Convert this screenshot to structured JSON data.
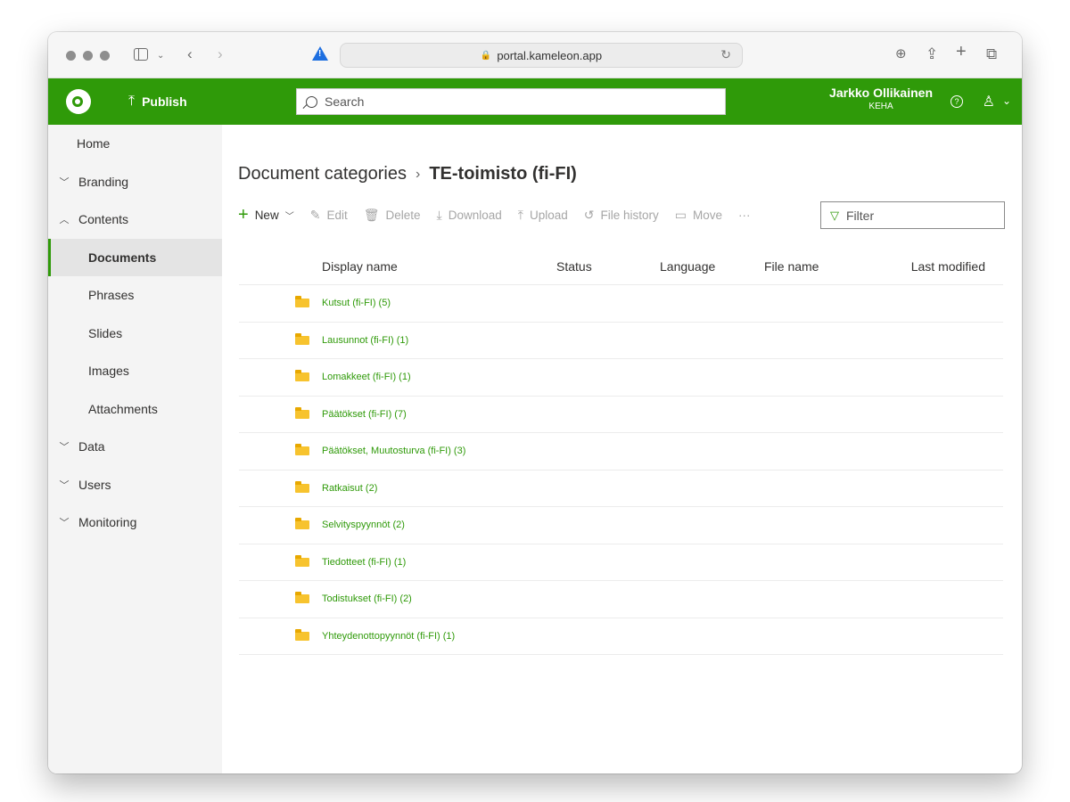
{
  "browser": {
    "url": "portal.kameleon.app"
  },
  "header": {
    "publish_label": "Publish",
    "search_placeholder": "Search",
    "user_name": "Jarkko Ollikainen",
    "user_org": "KEHA",
    "brand_color": "#2f9a09"
  },
  "nav": {
    "home": "Home",
    "branding": "Branding",
    "contents": "Contents",
    "documents": "Documents",
    "phrases": "Phrases",
    "slides": "Slides",
    "images": "Images",
    "attachments": "Attachments",
    "data": "Data",
    "users": "Users",
    "monitoring": "Monitoring"
  },
  "breadcrumb": {
    "parent": "Document categories",
    "current": "TE-toimisto (fi-FI)"
  },
  "commands": {
    "new": "New",
    "edit": "Edit",
    "delete": "Delete",
    "download": "Download",
    "upload": "Upload",
    "file_history": "File history",
    "move": "Move",
    "more": "···"
  },
  "filter": {
    "placeholder": "Filter"
  },
  "table": {
    "columns": {
      "display_name": "Display name",
      "status": "Status",
      "language": "Language",
      "file_name": "File name",
      "last_modified": "Last modified"
    },
    "rows": [
      "Kutsut (fi-FI) (5)",
      "Lausunnot (fi-FI) (1)",
      "Lomakkeet (fi-FI) (1)",
      "Päätökset (fi-FI) (7)",
      "Päätökset, Muutosturva (fi-FI) (3)",
      "Ratkaisut (2)",
      "Selvityspyynnöt (2)",
      "Tiedotteet (fi-FI) (1)",
      "Todistukset (fi-FI) (2)",
      "Yhteydenottopyynnöt (fi-FI) (1)"
    ]
  }
}
